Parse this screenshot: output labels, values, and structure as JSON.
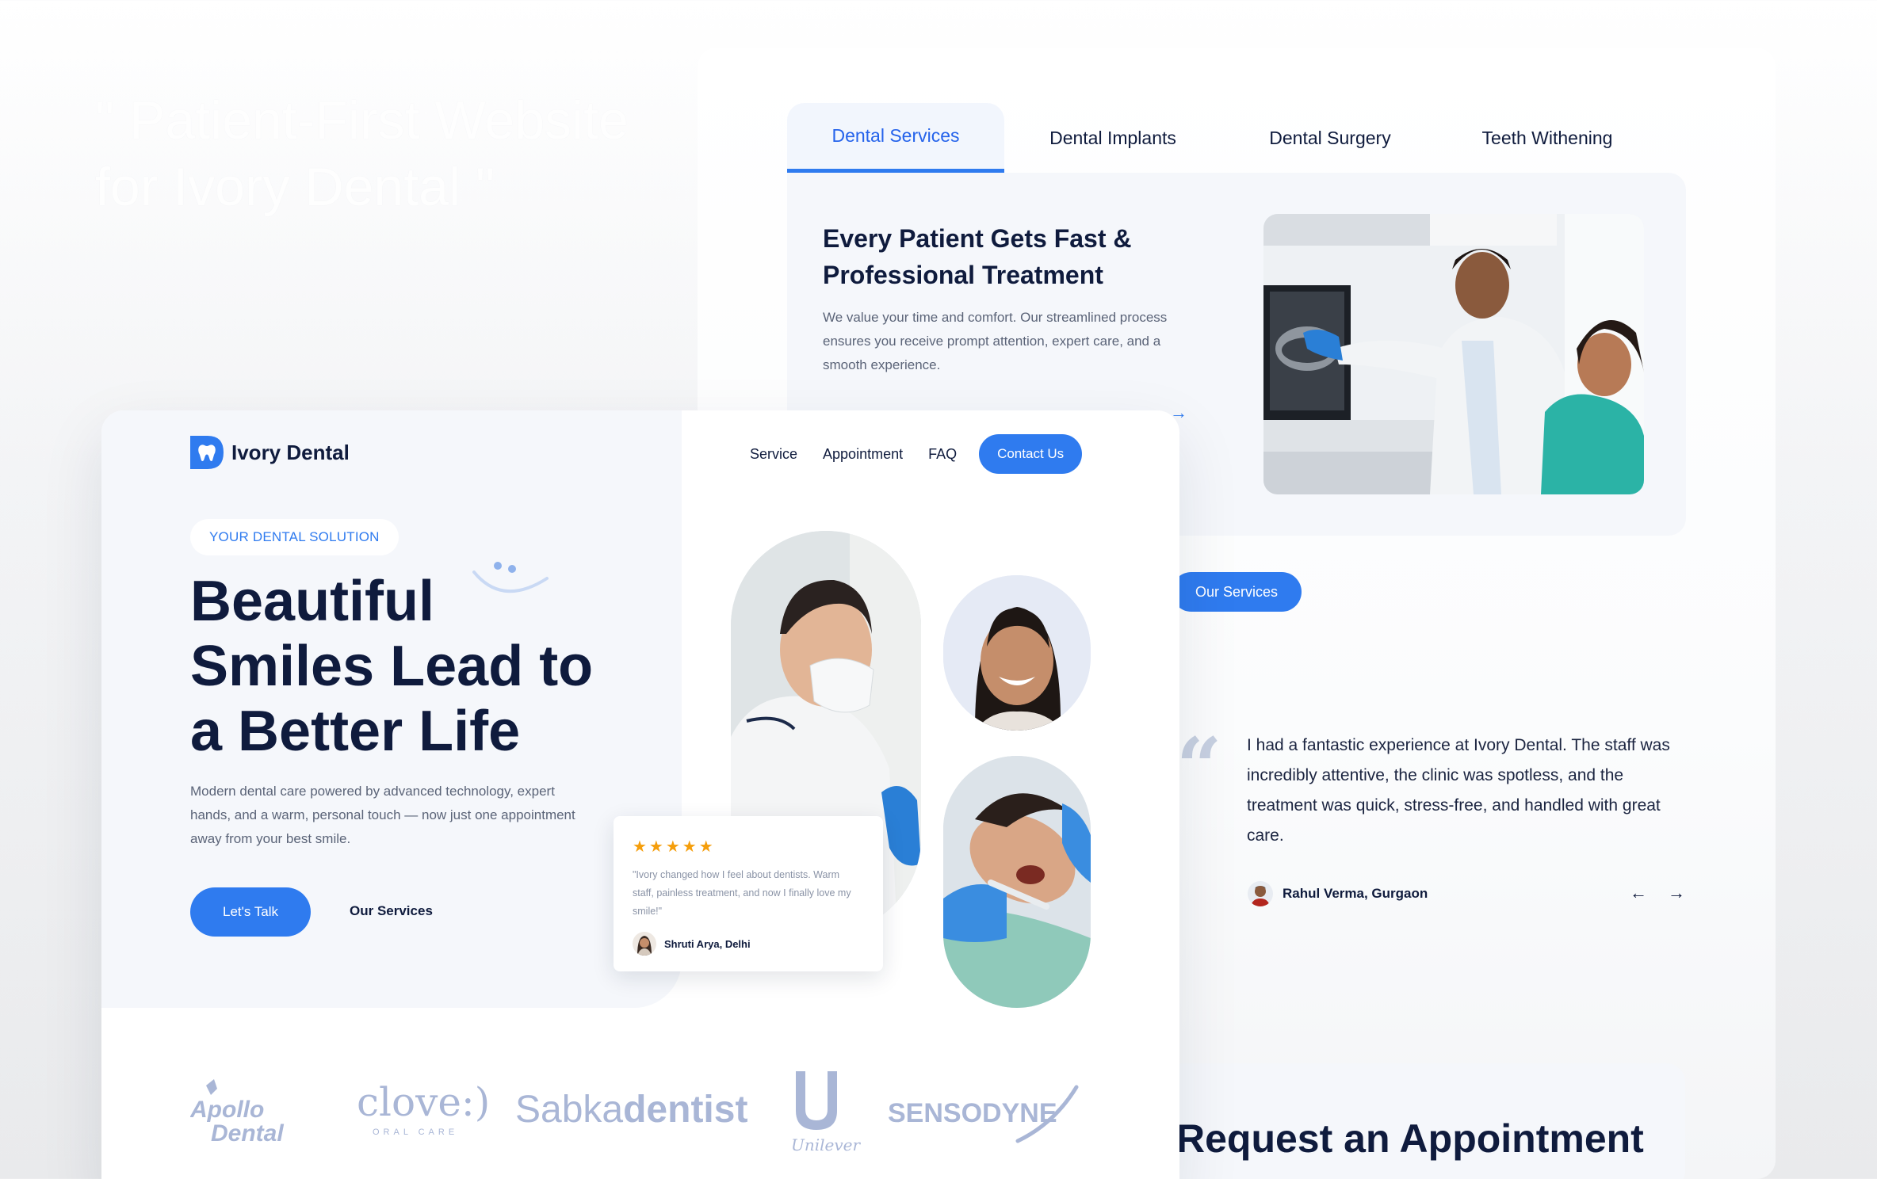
{
  "background_headline": "\" Patient-First Website for Ivory Dental \"",
  "services_page": {
    "tabs": [
      {
        "label": "Dental Services",
        "active": true
      },
      {
        "label": "Dental Implants",
        "active": false
      },
      {
        "label": "Dental Surgery",
        "active": false
      },
      {
        "label": "Teeth Withening",
        "active": false
      }
    ],
    "card": {
      "title": "Every Patient Gets Fast & Professional Treatment",
      "text": "We value your time and comfort. Our streamlined process ensures you receive prompt attention, expert care, and a smooth experience.",
      "arrow_icon": "arrow-right-icon"
    },
    "our_services_button": "Our Services",
    "testimonial": {
      "quote_icon": "quote-icon",
      "text": "I had a fantastic experience at Ivory Dental. The staff was incredibly attentive, the clinic was spotless, and the treatment was quick, stress-free, and handled with great care.",
      "author": "Rahul Verma, Gurgaon",
      "prev_icon": "arrow-left-icon",
      "next_icon": "arrow-right-icon"
    },
    "appointment_title": "Request an Appointment"
  },
  "landing": {
    "brand": "Ivory Dental",
    "nav": {
      "items": [
        "Service",
        "Appointment",
        "FAQ"
      ],
      "contact": "Contact Us"
    },
    "badge": "YOUR DENTAL SOLUTION",
    "hero_title": "Beautiful Smiles Lead to a Better Life",
    "hero_text": "Modern dental care powered by advanced technology, expert hands, and a warm, personal touch — now just one appointment away from your best smile.",
    "cta_primary": "Let's Talk",
    "cta_secondary": "Our Services",
    "review": {
      "stars": "★★★★★",
      "text": "\"Ivory changed how I feel about dentists. Warm staff, painless treatment, and now I finally love my smile!\"",
      "author": "Shruti Arya, Delhi"
    },
    "partners": {
      "apollo": [
        "Apollo",
        "Dental"
      ],
      "clove": [
        "clove:)",
        "ORAL CARE"
      ],
      "sabka": [
        "Sabka",
        "dentist"
      ],
      "unilever": "Unilever",
      "sensodyne": "SENSODYNE"
    }
  },
  "colors": {
    "accent": "#2f7bef",
    "navy": "#0f1b3d",
    "muted": "#5b6478",
    "panel": "#f5f7fb",
    "star": "#f59e0b",
    "logo_gray": "#a9b6d6"
  }
}
